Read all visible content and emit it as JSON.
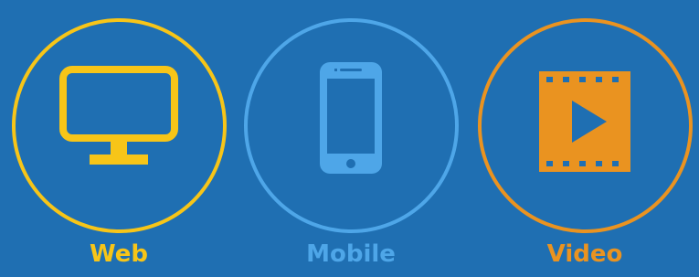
{
  "items": [
    {
      "key": "web",
      "label": "Web",
      "color": "#f7c518",
      "icon": "monitor-icon"
    },
    {
      "key": "mobile",
      "label": "Mobile",
      "color": "#4ea6e8",
      "icon": "smartphone-icon"
    },
    {
      "key": "video",
      "label": "Video",
      "color": "#ea9320",
      "icon": "film-play-icon"
    }
  ]
}
